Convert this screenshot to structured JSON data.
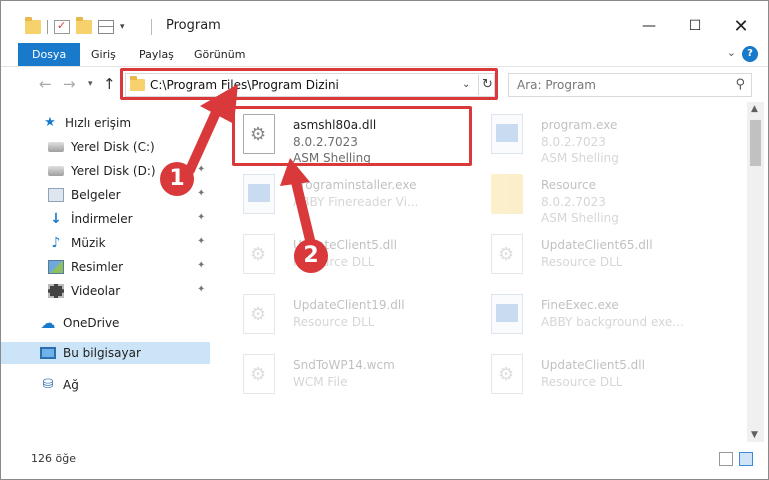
{
  "window": {
    "title": "Program",
    "controls": {
      "minimize": "—",
      "maximize": "☐",
      "close": "✕"
    }
  },
  "ribbon": {
    "tabs": [
      "Dosya",
      "Giriş",
      "Paylaş",
      "Görünüm"
    ],
    "help": "?",
    "collapse": "⌄"
  },
  "navigation": {
    "back": "←",
    "forward": "→",
    "recent": "▾",
    "up": "↑",
    "address": "C:\\Program Files\\Program Dizini",
    "address_dropdown": "⌄",
    "refresh": "↻",
    "search_placeholder": "Ara: Program",
    "search_icon": "⚲"
  },
  "sidebar": {
    "items": [
      {
        "label": "Hızlı erişim",
        "icon": "star-icon",
        "pinned": false
      },
      {
        "label": "Yerel Disk (C:)",
        "icon": "disk-icon",
        "pinned": true
      },
      {
        "label": "Yerel Disk (D:)",
        "icon": "disk-icon",
        "pinned": true
      },
      {
        "label": "Belgeler",
        "icon": "documents-icon",
        "pinned": true
      },
      {
        "label": "İndirmeler",
        "icon": "download-icon",
        "pinned": true
      },
      {
        "label": "Müzik",
        "icon": "music-icon",
        "pinned": true
      },
      {
        "label": "Resimler",
        "icon": "pictures-icon",
        "pinned": true
      },
      {
        "label": "Videolar",
        "icon": "videos-icon",
        "pinned": true
      },
      {
        "label": "OneDrive",
        "icon": "onedrive-icon",
        "pinned": false
      },
      {
        "label": "Bu bilgisayar",
        "icon": "this-pc-icon",
        "pinned": false,
        "selected": true
      },
      {
        "label": "Ağ",
        "icon": "network-icon",
        "pinned": false
      }
    ],
    "pin_glyph": "📌"
  },
  "files": [
    {
      "name": "asmshl80a.dll",
      "version": "8.0.2.7023",
      "desc": "ASM Shelling",
      "type": "dll",
      "highlighted": true
    },
    {
      "name": "program.exe",
      "version": "8.0.2.7023",
      "desc": "ASM Shelling",
      "type": "exe"
    },
    {
      "name": "programinstaller.exe",
      "version": "ABBY Finereader Vi...",
      "desc": "",
      "type": "exe"
    },
    {
      "name": "Resource",
      "version": "8.0.2.7023",
      "desc": "ASM Shelling",
      "type": "folder"
    },
    {
      "name": "UpdateClient5.dll",
      "version": "Resource DLL",
      "desc": "",
      "type": "dll"
    },
    {
      "name": "UpdateClient65.dll",
      "version": "Resource DLL",
      "desc": "",
      "type": "dll"
    },
    {
      "name": "UpdateClient19.dll",
      "version": "Resource DLL",
      "desc": "",
      "type": "dll"
    },
    {
      "name": "FineExec.exe",
      "version": "ABBY background exe...",
      "desc": "",
      "type": "exe"
    },
    {
      "name": "SndToWP14.wcm",
      "version": "WCM File",
      "desc": "",
      "type": "dll"
    },
    {
      "name": "UpdateClient5.dll",
      "version": "Resource DLL",
      "desc": "",
      "type": "dll"
    }
  ],
  "status": {
    "count": "126 öğe"
  },
  "callouts": [
    "1",
    "2"
  ],
  "colors": {
    "accent": "#1979ca",
    "highlight": "#d9393a",
    "selected_bg": "#cce4f7"
  }
}
